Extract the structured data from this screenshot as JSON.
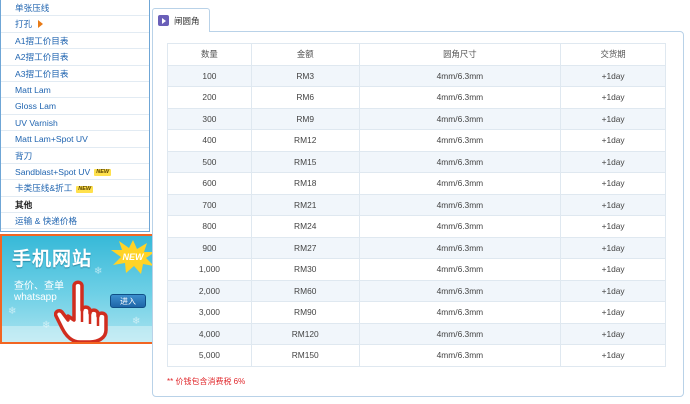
{
  "sidebar": {
    "items": [
      {
        "label": "单张压线"
      },
      {
        "label": "打孔"
      },
      {
        "label": "A1摺工价目表"
      },
      {
        "label": "A2摺工价目表"
      },
      {
        "label": "A3摺工价目表"
      },
      {
        "label": "Matt Lam"
      },
      {
        "label": "Gloss Lam"
      },
      {
        "label": "UV Varnish"
      },
      {
        "label": "Matt Lam+Spot UV"
      },
      {
        "label": "背刀"
      },
      {
        "label": "Sandblast+Spot UV",
        "badge": "NEW"
      },
      {
        "label": "卡类压线&折工",
        "badge": "NEW"
      },
      {
        "label": "其他"
      },
      {
        "label": "运输 & 快递价格"
      }
    ]
  },
  "banner": {
    "title": "手机网站",
    "new_label": "NEW",
    "line1": "查价、查单",
    "line2": "whatsapp",
    "enter_label": "进入"
  },
  "tab": {
    "label": "闸圆角",
    "icon": "play-icon"
  },
  "table": {
    "headers": [
      "数量",
      "金额",
      "圆角尺寸",
      "交货期"
    ],
    "rows": [
      [
        "100",
        "RM3",
        "4mm/6.3mm",
        "+1day"
      ],
      [
        "200",
        "RM6",
        "4mm/6.3mm",
        "+1day"
      ],
      [
        "300",
        "RM9",
        "4mm/6.3mm",
        "+1day"
      ],
      [
        "400",
        "RM12",
        "4mm/6.3mm",
        "+1day"
      ],
      [
        "500",
        "RM15",
        "4mm/6.3mm",
        "+1day"
      ],
      [
        "600",
        "RM18",
        "4mm/6.3mm",
        "+1day"
      ],
      [
        "700",
        "RM21",
        "4mm/6.3mm",
        "+1day"
      ],
      [
        "800",
        "RM24",
        "4mm/6.3mm",
        "+1day"
      ],
      [
        "900",
        "RM27",
        "4mm/6.3mm",
        "+1day"
      ],
      [
        "1,000",
        "RM30",
        "4mm/6.3mm",
        "+1day"
      ],
      [
        "2,000",
        "RM60",
        "4mm/6.3mm",
        "+1day"
      ],
      [
        "3,000",
        "RM90",
        "4mm/6.3mm",
        "+1day"
      ],
      [
        "4,000",
        "RM120",
        "4mm/6.3mm",
        "+1day"
      ],
      [
        "5,000",
        "RM150",
        "4mm/6.3mm",
        "+1day"
      ]
    ]
  },
  "footnote": "** 价钱包含消费税 6%",
  "colors": {
    "link": "#1f64b0",
    "border": "#b9d2e8",
    "row_alt": "#f1f6fb",
    "banner_border": "#f26522",
    "footnote": "#e0262a"
  }
}
